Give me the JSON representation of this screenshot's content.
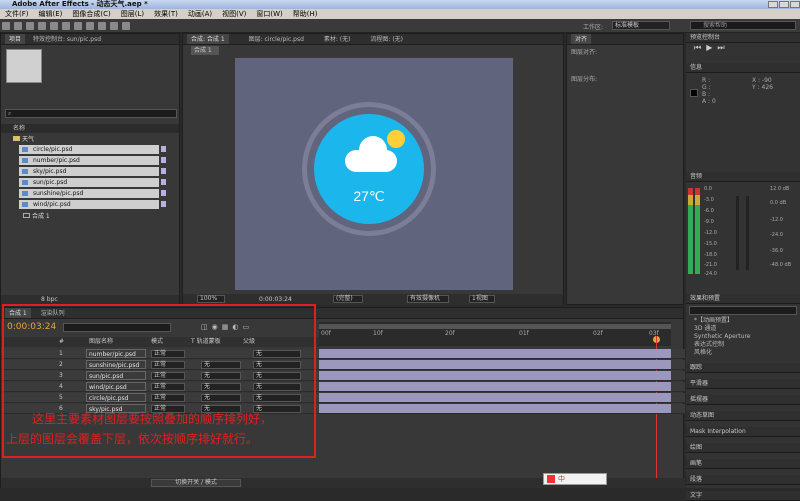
{
  "window": {
    "title": "Adobe After Effects - 动态天气.aep *"
  },
  "menu": [
    "文件(F)",
    "编辑(E)",
    "图像合成(C)",
    "图层(L)",
    "效果(T)",
    "动画(A)",
    "视图(V)",
    "窗口(W)",
    "帮助(H)"
  ],
  "toolbar": {
    "workspace_label": "工作区:",
    "workspace_value": "标准模板",
    "search_placeholder": "搜索帮助"
  },
  "project": {
    "tab1": "项目",
    "tab2": "特效控制台: sun/pic.psd",
    "col_name": "名称",
    "folder": "天气",
    "items": [
      "circle/pic.psd",
      "number/pic.psd",
      "sky/pic.psd",
      "sun/pic.psd",
      "sunshine/pic.psd",
      "wind/pic.psd"
    ],
    "comp": "合成 1",
    "footer": "8 bpc"
  },
  "viewer": {
    "tab_comp": "合成: 合成 1",
    "tab_layer": "图层: circle/pic.psd",
    "tab_footage": "素材: (无)",
    "tab_flow": "流程图: (无)",
    "sub_tab": "合成 1",
    "temperature": "27℃",
    "zoom": "100%",
    "timecode": "0:00:03:24",
    "view_mode": "(完整)",
    "camera": "有效摄像机",
    "view_count": "1视图"
  },
  "align": {
    "tab": "对齐",
    "align_to": "图层对齐:",
    "distribute": "图层分布:"
  },
  "preview": {
    "tab": "预览控制台"
  },
  "info": {
    "tab": "信息",
    "r": "R :",
    "g": "G :",
    "b": "B :",
    "a": "A : 0",
    "x": "X : -90",
    "y": "Y : 426"
  },
  "audio": {
    "tab": "音频",
    "left_db": [
      "0.0",
      "-3.0",
      "-6.0",
      "-9.0",
      "-12.0",
      "-15.0",
      "-18.0",
      "-21.0",
      "-24.0"
    ],
    "right_db": [
      "12.0 dB",
      "0.0 dB",
      "-12.0",
      "-24.0",
      "-36.0",
      "-48.0 dB"
    ]
  },
  "effects": {
    "tab": "效果和预置",
    "search_placeholder": "",
    "items": [
      "*【动画预置】",
      "3D 通道",
      "Synthetic Aperture",
      "表达式控制",
      "风格化"
    ]
  },
  "side_panels": [
    "跟踪",
    "平滑器",
    "摇摆器",
    "动态草图",
    "Mask Interpolation",
    "绘图",
    "画笔",
    "段落",
    "文字"
  ],
  "timeline": {
    "tab1": "合成 1",
    "tab2": "渲染队列",
    "time": "0:00:03:24",
    "search_placeholder": "",
    "col_num": "#",
    "col_name": "图层名称",
    "col_mode": "模式",
    "col_trk": "T  轨道蒙板",
    "col_parent": "父级",
    "ruler": [
      "00f",
      "10f",
      "20f",
      "01f",
      "02f",
      "03f"
    ],
    "layers": [
      {
        "num": "1",
        "name": "number/pic.psd",
        "mode": "正常",
        "trk": "",
        "parent": "无"
      },
      {
        "num": "2",
        "name": "sunshine/pic.psd",
        "mode": "正常",
        "trk": "无",
        "parent": "无"
      },
      {
        "num": "3",
        "name": "sun/pic.psd",
        "mode": "正常",
        "trk": "无",
        "parent": "无"
      },
      {
        "num": "4",
        "name": "wind/pic.psd",
        "mode": "正常",
        "trk": "无",
        "parent": "无"
      },
      {
        "num": "5",
        "name": "circle/pic.psd",
        "mode": "正常",
        "trk": "无",
        "parent": "无"
      },
      {
        "num": "6",
        "name": "sky/pic.psd",
        "mode": "正常",
        "trk": "无",
        "parent": "无"
      }
    ],
    "footer": "切换开关 / 模式"
  },
  "annotation": {
    "line1": "这里主要素材图层要按照叠加的顺序排列好，",
    "line2": "上层的图层会覆盖下层，依次按顺序排好就行。",
    "color": "#e02020"
  },
  "ime": {
    "label": "中"
  }
}
